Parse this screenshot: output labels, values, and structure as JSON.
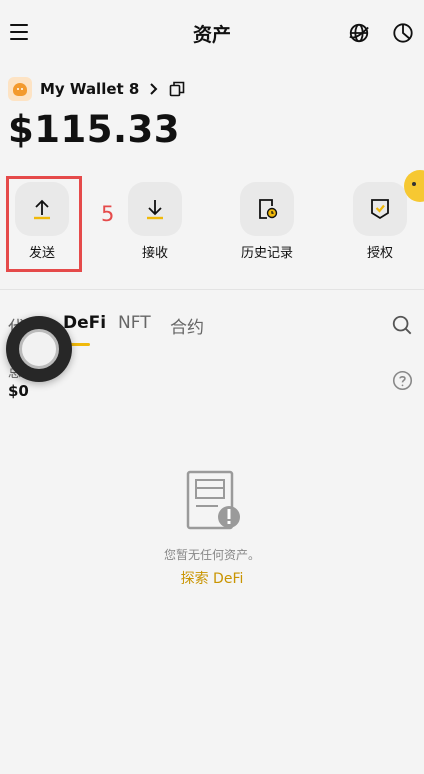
{
  "header": {
    "title": "资产"
  },
  "wallet": {
    "name": "My Wallet 8",
    "balance": "$115.33"
  },
  "actions": [
    {
      "label": "发送"
    },
    {
      "label": "接收"
    },
    {
      "label": "历史记录"
    },
    {
      "label": "授权"
    }
  ],
  "annotation": {
    "step": "5",
    "color": "#e54a4a"
  },
  "tabs": [
    {
      "label": "代币"
    },
    {
      "label": "DeFi",
      "active": true
    },
    {
      "label": "NFT"
    },
    {
      "label": "合约"
    }
  ],
  "summary": {
    "label": "总",
    "value": "$0"
  },
  "empty_state": {
    "message": "您暂无任何资产。",
    "link": "探索 DeFi"
  },
  "colors": {
    "accent": "#f0b90b",
    "link": "#c99400",
    "annotation": "#e54a4a"
  }
}
